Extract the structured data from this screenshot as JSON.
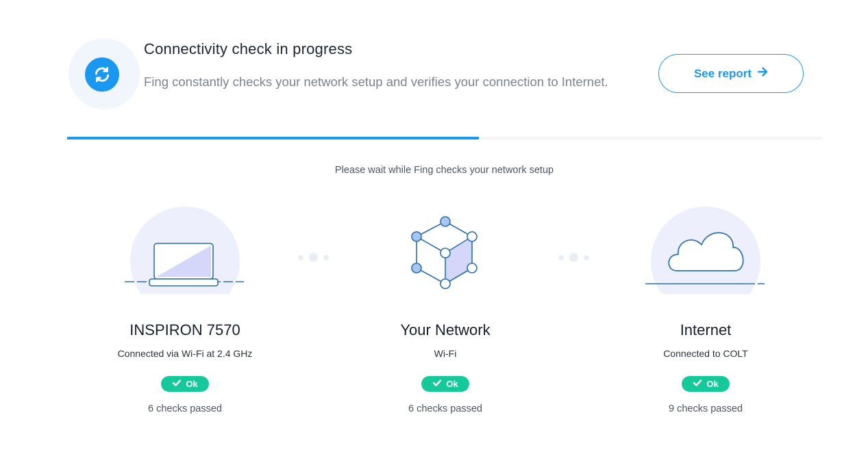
{
  "header": {
    "title": "Connectivity check in progress",
    "subtitle": "Fing constantly checks your network setup and verifies your connection to Internet.",
    "report_button": "See report",
    "progress_fraction": 0.545,
    "accent_color": "#1a97f0"
  },
  "main": {
    "wait_text": "Please wait while Fing checks your network setup",
    "items": [
      {
        "icon": "laptop-icon",
        "name": "INSPIRON 7570",
        "detail": "Connected via Wi-Fi at 2.4 GHz",
        "status": "Ok",
        "checks": "6 checks passed"
      },
      {
        "icon": "network-cube-icon",
        "name": "Your Network",
        "detail": "Wi-Fi",
        "status": "Ok",
        "checks": "6 checks passed"
      },
      {
        "icon": "cloud-icon",
        "name": "Internet",
        "detail": "Connected to COLT",
        "status": "Ok",
        "checks": "9 checks passed"
      }
    ],
    "status_color": "#16c99a"
  }
}
